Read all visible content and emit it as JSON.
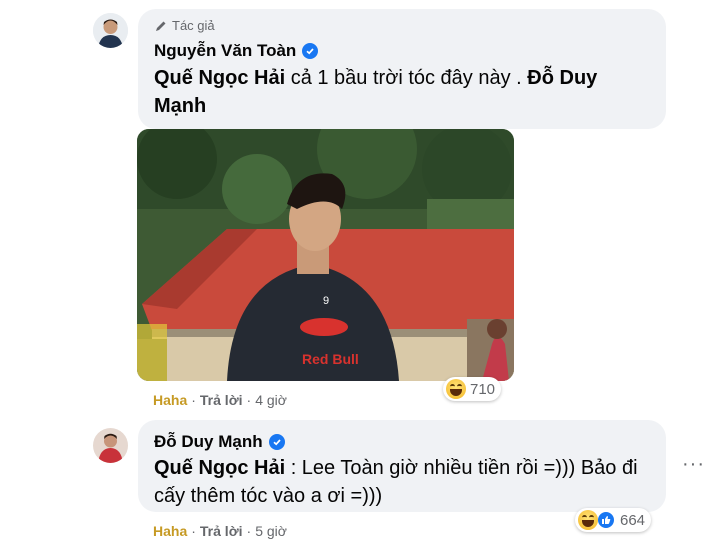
{
  "comment1": {
    "author_tag": "Tác giả",
    "author_name": "Nguyễn Văn Toàn",
    "mention": "Quế Ngọc Hải",
    "text_mid": " cả 1 bầu trời tóc đây này . ",
    "mention2": "Đỗ Duy Mạnh",
    "action_haha": "Haha",
    "action_reply": "Trả lời",
    "time": "4 giờ",
    "reaction_count": "710",
    "photo": {
      "jersey_number": "9",
      "sponsor": "Red Bull"
    }
  },
  "comment2": {
    "author_name": "Đỗ Duy Mạnh",
    "mention": "Quế Ngọc Hải",
    "text": " : Lee Toàn giờ nhiều tiền rồi =))) Bảo đi cấy thêm tóc vào a ơi =)))",
    "action_haha": "Haha",
    "action_reply": "Trả lời",
    "time": "5 giờ",
    "reaction_count": "664",
    "more": "···"
  },
  "colors": {
    "bubble": "#f0f2f5",
    "verified": "#1877f2",
    "haha": "#c69a24",
    "roof": "#c94a3c"
  }
}
